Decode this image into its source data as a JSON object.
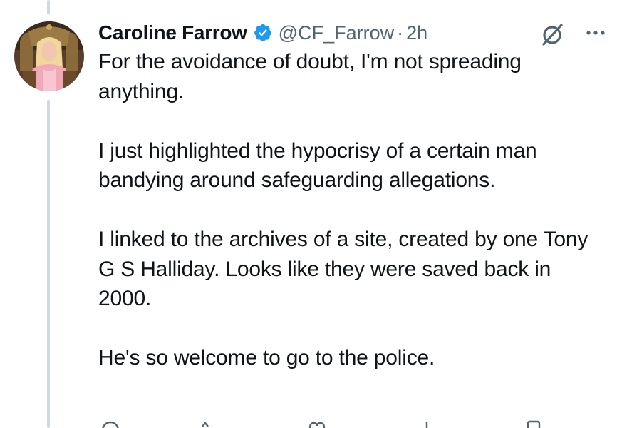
{
  "tweet": {
    "author_name": "Caroline Farrow",
    "handle": "@CF_Farrow",
    "separator": "·",
    "time": "2h",
    "paragraphs": [
      "For the avoidance of doubt, I'm not spreading anything.",
      "I just highlighted the hypocrisy of a certain man bandying around safeguarding allegations.",
      "I linked to the archives of a site, created by one Tony G S Halliday. Looks like they were saved back in 2000.",
      "He's so welcome to go to the police."
    ]
  },
  "icons": {
    "verified": "verified-badge-icon",
    "grok": "grok-icon",
    "more": "more-options-icon",
    "reply": "reply-icon",
    "repost": "repost-icon",
    "like": "like-icon",
    "views": "views-icon",
    "bookmark": "bookmark-icon"
  },
  "colors": {
    "text": "#0f1419",
    "secondary": "#536471",
    "verified": "#1d9bf0",
    "thread_line": "#cfd9de"
  }
}
